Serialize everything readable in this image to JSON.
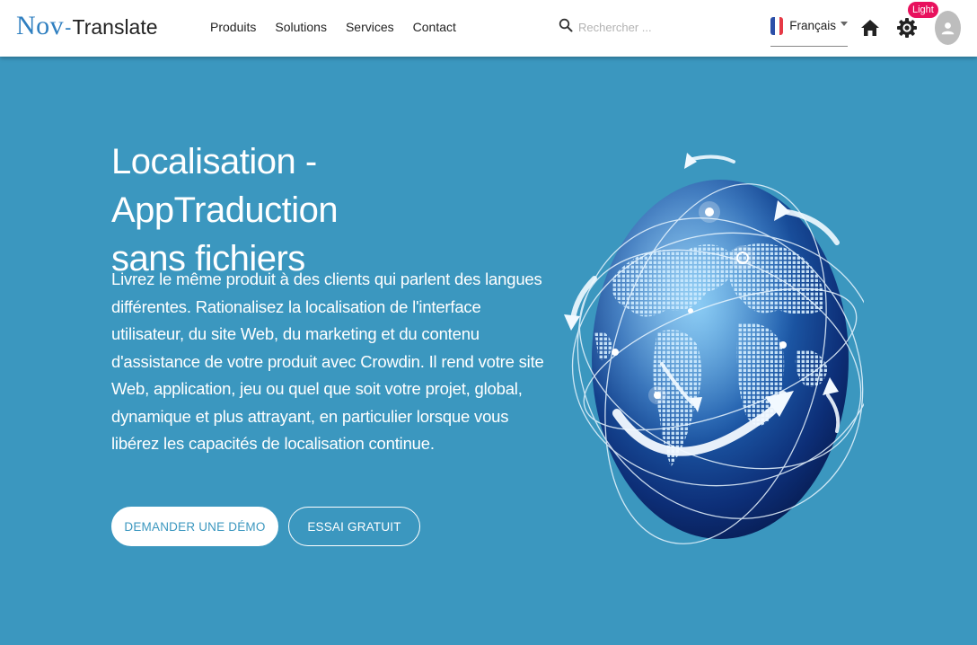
{
  "header": {
    "logo_nov": "Nov",
    "logo_dash": "-",
    "logo_translate": "Translate",
    "nav": [
      "Produits",
      "Solutions",
      "Services",
      "Contact"
    ],
    "search_placeholder": "Rechercher ...",
    "language": "Français",
    "theme_badge": "Light"
  },
  "hero": {
    "title_line1": "Localisation - AppTraduction",
    "title_line2": "sans fichiers",
    "description": "Livrez le même produit à des clients qui parlent des langues différentes. Rationalisez la localisation de l'interface utilisateur, du site Web, du marketing et du contenu d'assistance de votre produit avec Crowdin. Il rend votre site Web, application, jeu ou quel que soit votre projet, global, dynamique et plus attrayant, en particulier lorsque vous libérez les capacités de localisation continue.",
    "demo_button": "DEMANDER UNE DÉMO",
    "trial_button": "ESSAI GRATUIT"
  },
  "icons": {
    "search": "search-icon",
    "flag": "france-flag-icon",
    "home": "home-icon",
    "theme": "gear-icon",
    "avatar": "user-avatar-icon",
    "illustration": "globe-illustration"
  },
  "colors": {
    "background": "#3b97bf",
    "brand": "#2f7fc0",
    "badge": "#e8115d",
    "navbar": "#ffffff"
  }
}
